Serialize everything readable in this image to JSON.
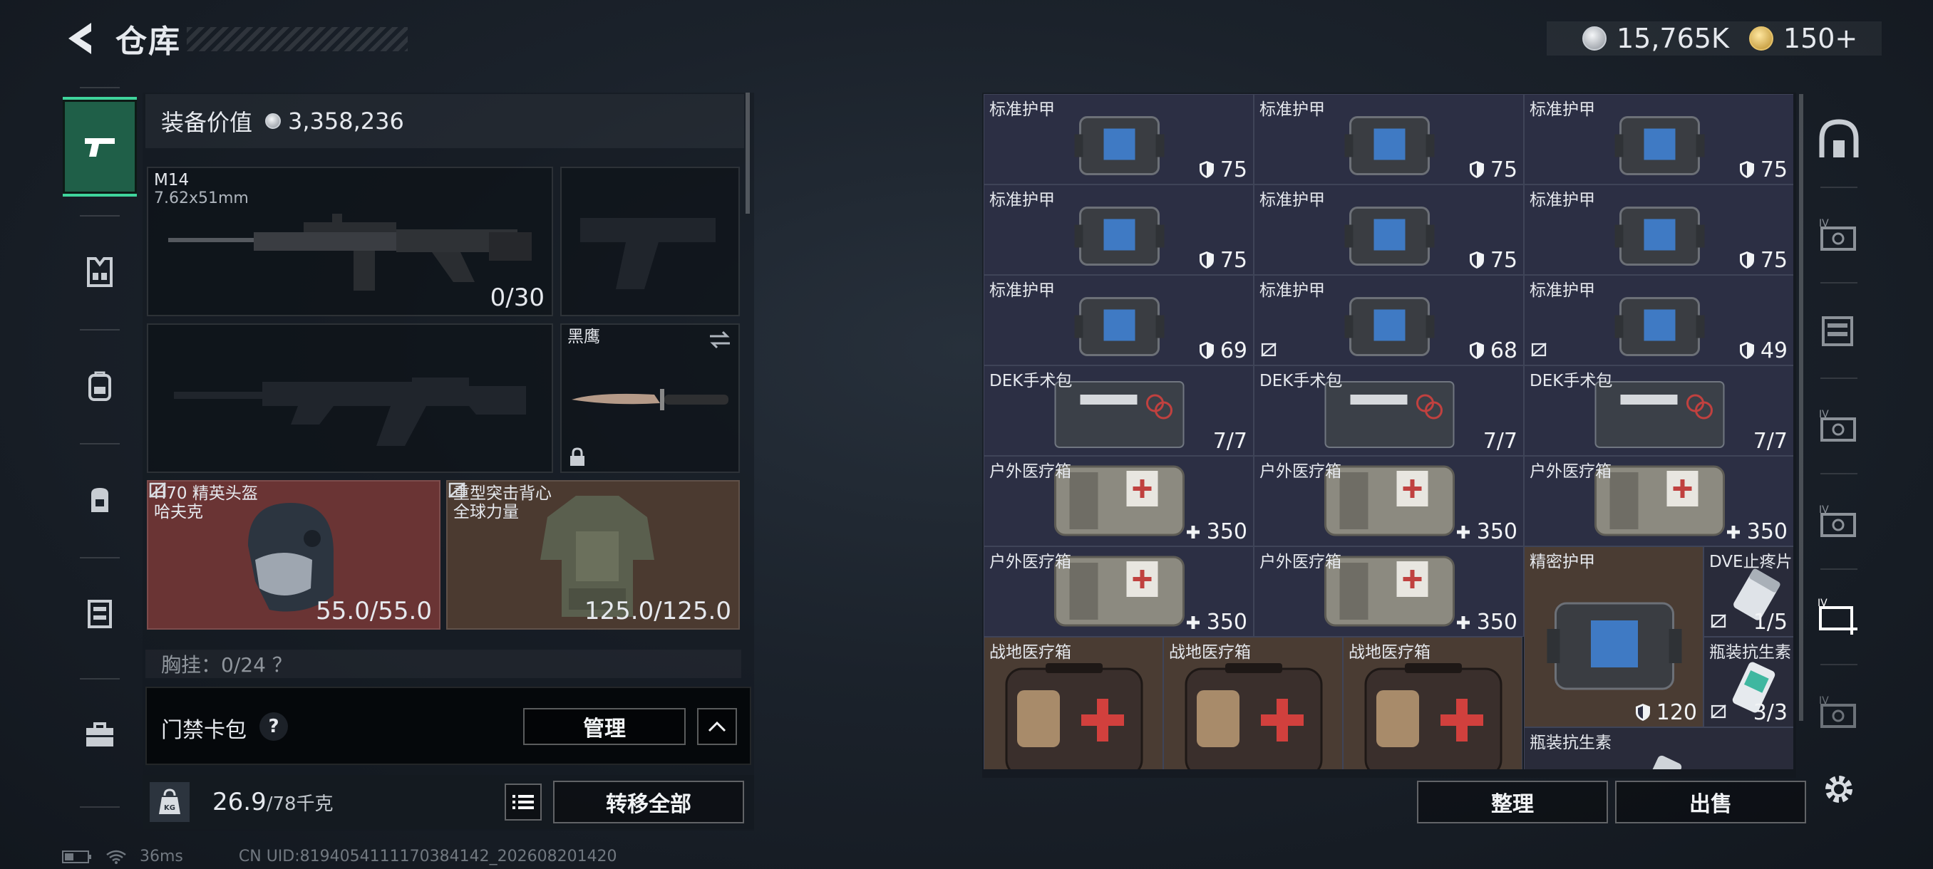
{
  "header": {
    "title": "仓库",
    "currency_silver": "15,765K",
    "currency_gold": "150+"
  },
  "loadout": {
    "equip_value_label": "装备价值",
    "equip_value": "3,358,236",
    "primary": {
      "name": "M14",
      "caliber": "7.62x51mm",
      "ammo": "0/30"
    },
    "melee": {
      "name": "黑鹰"
    },
    "helmet": {
      "name": "H70 精英头盔",
      "brand": "哈夫克",
      "durability": "55.0/55.0"
    },
    "armor": {
      "name": "重型突击背心",
      "brand": "全球力量",
      "durability": "125.0/125.0"
    },
    "chest_rig": "胸挂：0/24 ？",
    "keycard_label": "门禁卡包",
    "keycard_help": "?",
    "manage_label": "管理",
    "weight_current": "26.9",
    "weight_max": "/78千克",
    "weight_icon": "KG",
    "transfer_all_label": "转移全部"
  },
  "warehouse": {
    "items": [
      {
        "name": "标准护甲",
        "value": "75",
        "icon": "shield"
      },
      {
        "name": "标准护甲",
        "value": "75",
        "icon": "shield"
      },
      {
        "name": "标准护甲",
        "value": "75",
        "icon": "shield"
      },
      {
        "name": "标准护甲",
        "value": "75",
        "icon": "shield"
      },
      {
        "name": "标准护甲",
        "value": "75",
        "icon": "shield"
      },
      {
        "name": "标准护甲",
        "value": "75",
        "icon": "shield"
      },
      {
        "name": "标准护甲",
        "value": "69",
        "icon": "shield"
      },
      {
        "name": "标准护甲",
        "value": "68",
        "icon": "shield"
      },
      {
        "name": "标准护甲",
        "value": "49",
        "icon": "shield"
      },
      {
        "name": "DEK手术包",
        "value": "7/7",
        "icon": ""
      },
      {
        "name": "DEK手术包",
        "value": "7/7",
        "icon": ""
      },
      {
        "name": "DEK手术包",
        "value": "7/7",
        "icon": ""
      },
      {
        "name": "户外医疗箱",
        "value": "350",
        "icon": "plus"
      },
      {
        "name": "户外医疗箱",
        "value": "350",
        "icon": "plus"
      },
      {
        "name": "户外医疗箱",
        "value": "350",
        "icon": "plus"
      },
      {
        "name": "户外医疗箱",
        "value": "350",
        "icon": "plus"
      },
      {
        "name": "户外医疗箱",
        "value": "350",
        "icon": "plus"
      },
      {
        "name": "精密护甲",
        "value": "120",
        "icon": "shield"
      },
      {
        "name": "DVE止疼片",
        "value": "1/5",
        "icon": ""
      },
      {
        "name": "瓶装抗生素",
        "value": "3/3",
        "icon": ""
      },
      {
        "name": "战地医疗箱",
        "value": "",
        "icon": ""
      },
      {
        "name": "战地医疗箱",
        "value": "",
        "icon": ""
      },
      {
        "name": "战地医疗箱",
        "value": "",
        "icon": ""
      },
      {
        "name": "瓶装抗生素",
        "value": "",
        "icon": ""
      }
    ],
    "sort_label": "整理",
    "sell_label": "出售"
  },
  "status": {
    "ping": "36ms",
    "uid": "CN UID:8194054111170384142_202608201420"
  }
}
